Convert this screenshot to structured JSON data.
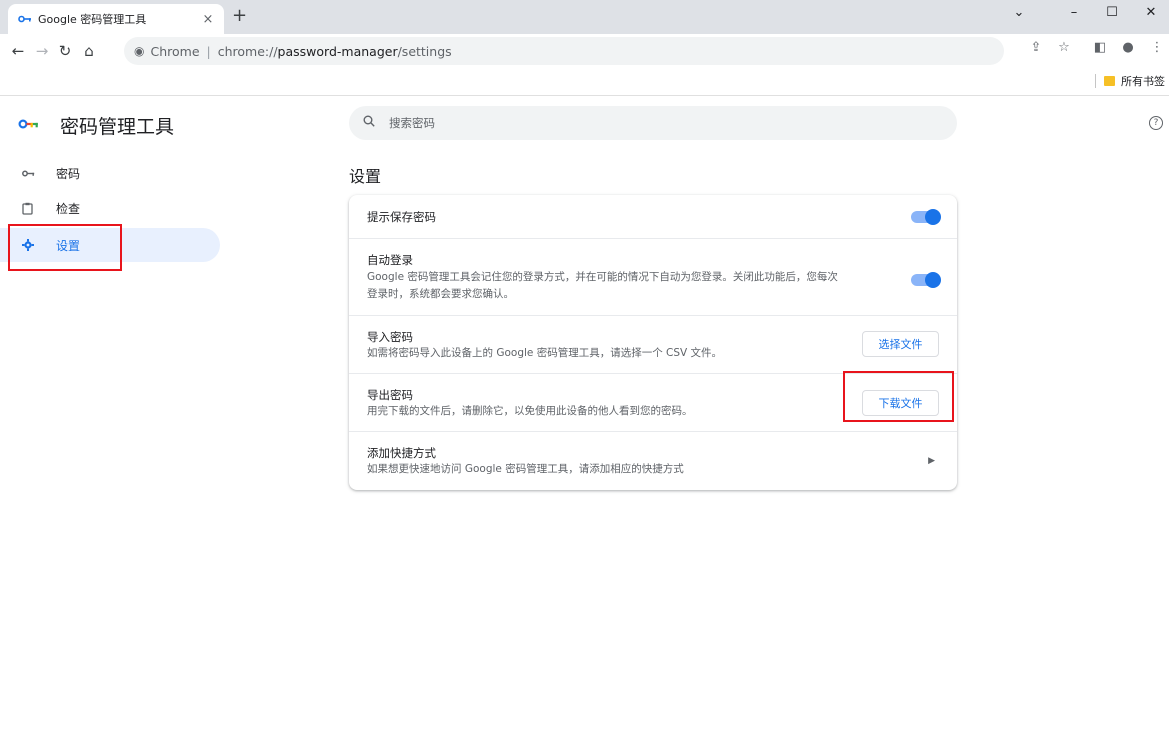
{
  "browser": {
    "tab_title": "Google 密码管理工具",
    "tab_close": "×",
    "new_tab": "+",
    "window_controls": {
      "dropdown": "⌄",
      "minimize": "–",
      "maximize": "☐",
      "close": "✕"
    },
    "omnibox": {
      "site_chip": "Chrome",
      "scheme": "chrome://",
      "host": "password-manager",
      "path": "/settings"
    },
    "bookmarks_folder": "所有书签"
  },
  "app": {
    "title": "密码管理工具",
    "search_placeholder": "搜索密码",
    "help": "?",
    "sidebar": [
      {
        "label": "密码",
        "icon": "key-icon"
      },
      {
        "label": "检查",
        "icon": "checkup-icon"
      },
      {
        "label": "设置",
        "icon": "gear-icon",
        "active": true
      }
    ],
    "section_title": "设置",
    "settings": {
      "offer_save": {
        "label": "提示保存密码",
        "enabled": true
      },
      "auto_signin": {
        "label": "自动登录",
        "sub_line1": "Google 密码管理工具会记住您的登录方式，并在可能的情况下自动为您登录。关闭此功能后，您每次",
        "sub_line2": "登录时，系统都会要求您确认。",
        "enabled": true
      },
      "import": {
        "label": "导入密码",
        "sub": "如需将密码导入此设备上的 Google 密码管理工具，请选择一个 CSV 文件。",
        "button": "选择文件"
      },
      "export": {
        "label": "导出密码",
        "sub": "用完下载的文件后，请删除它，以免使用此设备的他人看到您的密码。",
        "button": "下载文件"
      },
      "shortcut": {
        "label": "添加快捷方式",
        "sub": "如果想更快速地访问 Google 密码管理工具，请添加相应的快捷方式"
      }
    }
  },
  "colors": {
    "accent": "#1a73e8",
    "highlight": "#e8141c",
    "active_bg": "#e8f0fe"
  }
}
